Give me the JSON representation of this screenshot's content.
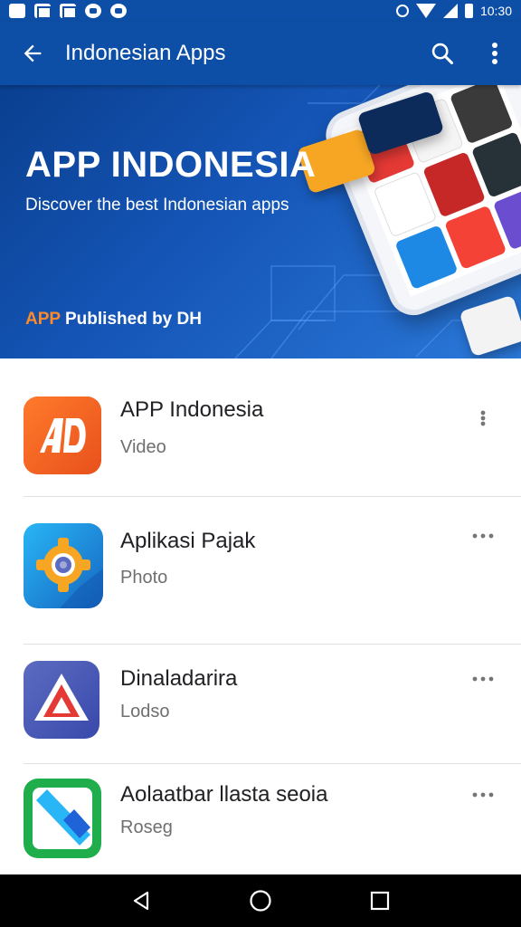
{
  "status_bar": {
    "time": "10:30"
  },
  "app_bar": {
    "title": "Indonesian Apps"
  },
  "banner": {
    "headline": "APP INDONESIA",
    "subtitle": "Discover the best Indonesian apps",
    "publisher_accent": "APP",
    "publisher_rest": " Published by DH"
  },
  "apps": [
    {
      "title": "APP Indonesia",
      "subtitle": "Video",
      "overflow": "vertical"
    },
    {
      "title": "Aplikasi Pajak",
      "subtitle": "Photo",
      "overflow": "horizontal"
    },
    {
      "title": "Dinaladarira",
      "subtitle": "Lodso",
      "overflow": "horizontal"
    },
    {
      "title": "Aolaatbar llasta seoia",
      "subtitle": "Roseg",
      "overflow": "horizontal"
    }
  ],
  "colors": {
    "primary": "#0d4fa6",
    "banner_light": "#2b79d9",
    "accent_orange": "#ff8a2a",
    "nav": "#000000"
  },
  "icons": {
    "app_1": "ad-logo-icon",
    "app_2": "gear-lens-icon",
    "app_3": "triangle-a-icon",
    "app_4": "diagonal-bar-icon"
  }
}
